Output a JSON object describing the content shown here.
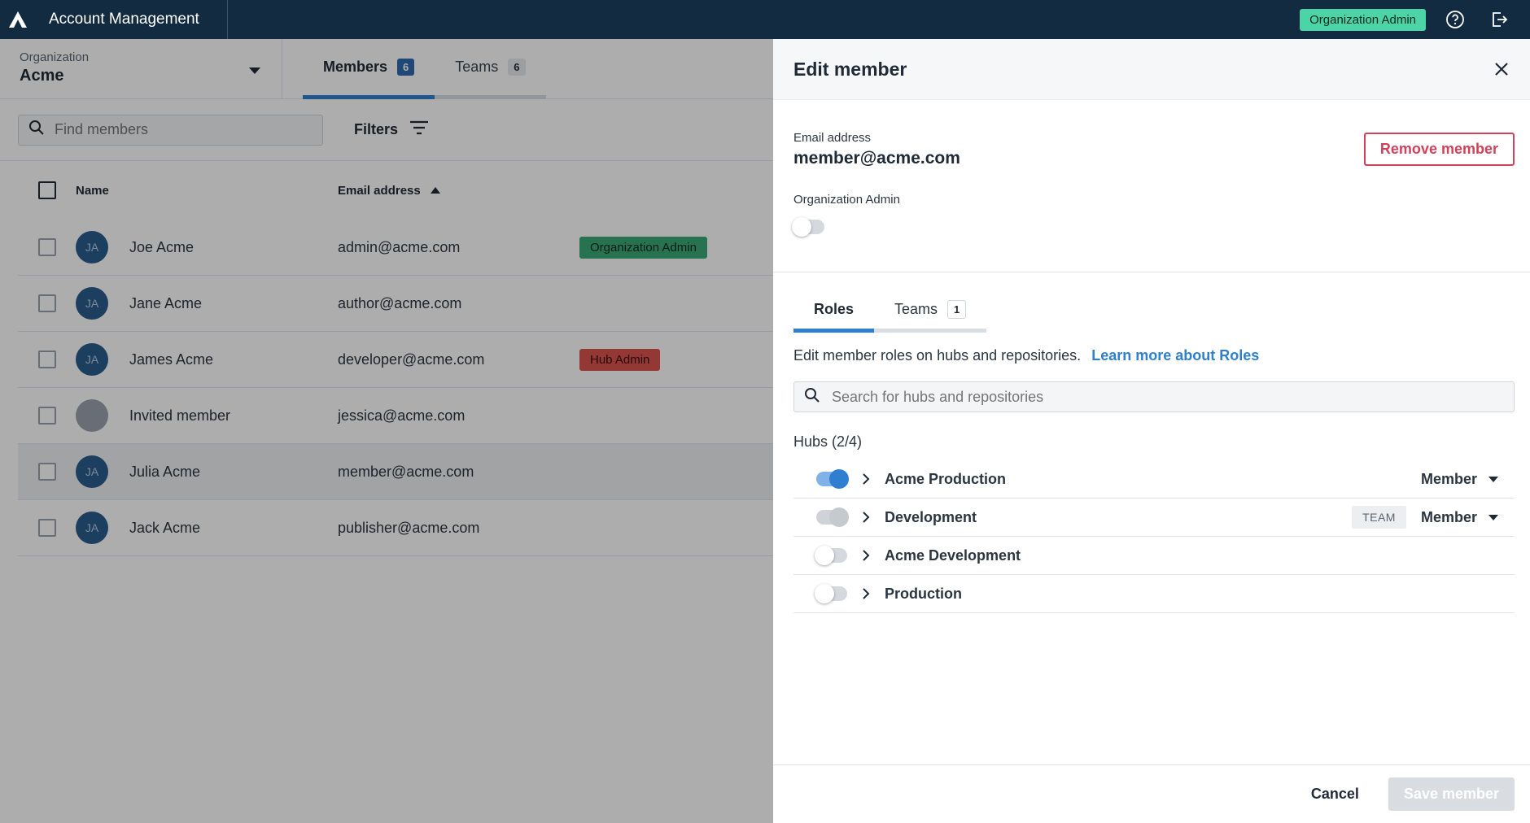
{
  "header": {
    "app_title": "Account Management",
    "role_badge": "Organization Admin",
    "logo_icon": "amplience-logo-icon",
    "help_icon": "help-circle-icon",
    "logout_icon": "logout-icon"
  },
  "org": {
    "label": "Organization",
    "name": "Acme"
  },
  "tabs": [
    {
      "label": "Members",
      "count": "6",
      "active": true
    },
    {
      "label": "Teams",
      "count": "6",
      "active": false
    }
  ],
  "toolbar": {
    "search_placeholder": "Find members",
    "filters_label": "Filters"
  },
  "table": {
    "columns": {
      "name": "Name",
      "email": "Email address"
    },
    "rows": [
      {
        "initials": "JA",
        "name": "Joe Acme",
        "email": "admin@acme.com",
        "badge": "Organization Admin",
        "badge_type": "org"
      },
      {
        "initials": "JA",
        "name": "Jane Acme",
        "email": "author@acme.com",
        "badge": "",
        "badge_type": ""
      },
      {
        "initials": "JA",
        "name": "James Acme",
        "email": "developer@acme.com",
        "badge": "Hub Admin",
        "badge_type": "hub"
      },
      {
        "initials": "",
        "name": "Invited member",
        "email": "jessica@acme.com",
        "badge": "",
        "badge_type": ""
      },
      {
        "initials": "JA",
        "name": "Julia Acme",
        "email": "member@acme.com",
        "badge": "",
        "badge_type": ""
      },
      {
        "initials": "JA",
        "name": "Jack Acme",
        "email": "publisher@acme.com",
        "badge": "",
        "badge_type": ""
      }
    ]
  },
  "panel": {
    "title": "Edit member",
    "email_label": "Email address",
    "email_value": "member@acme.com",
    "remove_label": "Remove member",
    "org_admin_label": "Organization Admin",
    "org_admin_enabled": false,
    "tabs": [
      {
        "label": "Roles",
        "count": "",
        "active": true
      },
      {
        "label": "Teams",
        "count": "1",
        "active": false
      }
    ],
    "roles_description": "Edit member roles on hubs and repositories.",
    "roles_link": "Learn more about Roles",
    "hub_search_placeholder": "Search for hubs and repositories",
    "hubs_heading": "Hubs (2/4)",
    "hubs": [
      {
        "name": "Acme Production",
        "state": "on",
        "team_tag": "",
        "role": "Member"
      },
      {
        "name": "Development",
        "state": "inherited",
        "team_tag": "TEAM",
        "role": "Member"
      },
      {
        "name": "Acme Development",
        "state": "off",
        "team_tag": "",
        "role": ""
      },
      {
        "name": "Production",
        "state": "off",
        "team_tag": "",
        "role": ""
      }
    ],
    "cancel_label": "Cancel",
    "save_label": "Save member"
  },
  "colors": {
    "topbar": "#132b40",
    "accent": "#2f7fd0",
    "org_admin_badge": "#4cd3a6",
    "danger": "#d1425a"
  }
}
